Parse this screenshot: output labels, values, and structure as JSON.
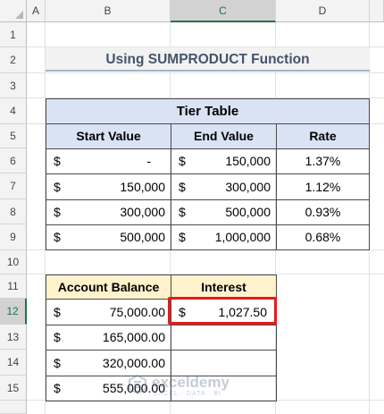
{
  "columns": [
    "A",
    "B",
    "C",
    "D"
  ],
  "rows": [
    "1",
    "2",
    "3",
    "4",
    "5",
    "6",
    "7",
    "8",
    "9",
    "10",
    "11",
    "12",
    "13",
    "14",
    "15"
  ],
  "selected_column": "C",
  "selected_row": "12",
  "title": "Using SUMPRODUCT Function",
  "tier_table": {
    "caption": "Tier Table",
    "headers": [
      "Start Value",
      "End Value",
      "Rate"
    ],
    "currency_symbol": "$",
    "rows": [
      {
        "start": "-",
        "end": "150,000",
        "rate": "1.37%"
      },
      {
        "start": "150,000",
        "end": "300,000",
        "rate": "1.12%"
      },
      {
        "start": "300,000",
        "end": "500,000",
        "rate": "0.93%"
      },
      {
        "start": "500,000",
        "end": "1,000,000",
        "rate": "0.68%"
      }
    ]
  },
  "balance_table": {
    "headers": [
      "Account Balance",
      "Interest"
    ],
    "currency_symbol": "$",
    "rows": [
      {
        "balance": "75,000.00",
        "interest": "1,027.50"
      },
      {
        "balance": "165,000.00",
        "interest": ""
      },
      {
        "balance": "320,000.00",
        "interest": ""
      },
      {
        "balance": "555,000.00",
        "interest": ""
      }
    ]
  },
  "watermark": {
    "name": "exceldemy",
    "tagline": "EXCEL · DATA · BI"
  },
  "colors": {
    "header_blue": "#dae3f3",
    "header_gold": "#fff2cc",
    "highlight": "#e01e1e",
    "excel_green": "#217346"
  }
}
